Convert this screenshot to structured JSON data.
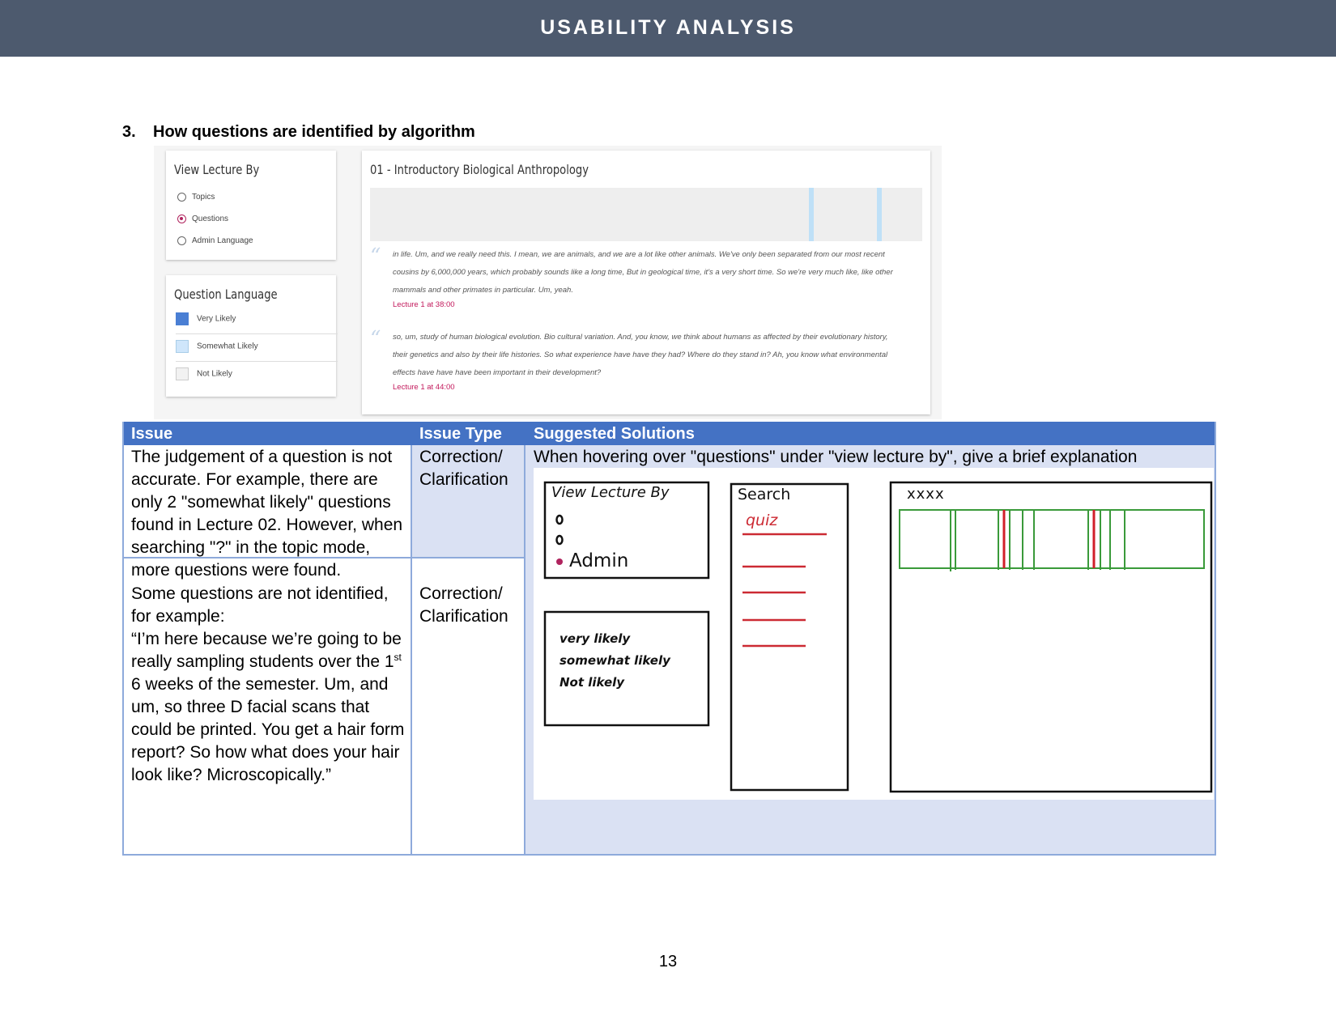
{
  "header": {
    "title": "USABILITY ANALYSIS"
  },
  "section": {
    "number": "3.",
    "title": "How questions are identified by algorithm"
  },
  "app": {
    "view_by": {
      "title": "View Lecture By",
      "options": [
        {
          "label": "Topics",
          "selected": false
        },
        {
          "label": "Questions",
          "selected": true
        },
        {
          "label": "Admin Language",
          "selected": false
        }
      ]
    },
    "question_language": {
      "title": "Question Language",
      "levels": [
        {
          "label": "Very Likely",
          "color": "#4a7fd4"
        },
        {
          "label": "Somewhat Likely",
          "color": "#cfe6fb"
        },
        {
          "label": "Not Likely",
          "color": "#f2f2f2"
        }
      ]
    },
    "lecture": {
      "title": "01 - Introductory Biological Anthropology",
      "quotes": [
        {
          "text": "in life. Um, and we really need this. I mean, we are animals, and we are a lot like other animals. We've only been separated from our most recent cousins by 6,000,000 years, which probably sounds like a long time, But in geological time, it's a very short time. So we're very much like, like other mammals and other primates in particular. Um, yeah.",
          "ref": "Lecture 1 at 38:00"
        },
        {
          "text": "so, um, study of human biological evolution. Bio cultural variation. And, you know, we think about humans as affected by their evolutionary history, their genetics and also by their life histories. So what experience have have they had? Where do they stand in? Ah, you know what environmental effects have have have been important in their development?",
          "ref": "Lecture 1 at 44:00"
        }
      ]
    }
  },
  "table": {
    "headers": {
      "issue": "Issue",
      "type": "Issue Type",
      "solution": "Suggested Solutions"
    },
    "rows": [
      {
        "issue": "The judgement of a question is not accurate. For example, there are only 2 \"somewhat likely\" questions found in Lecture 02. However, when searching \"?\" in the topic mode, more questions were found.",
        "type_line1": "Correction/",
        "type_line2": "Clarification",
        "solution": "When hovering over \"questions\" under \"view lecture by\", give a brief explanation"
      },
      {
        "issue_part1": "Some questions are not identified, for example:",
        "issue_part2": "“I’m here because we’re going to be really sampling students over the 1",
        "issue_sup": "st",
        "issue_part3": " 6 weeks of the semester. Um, and um, so three D facial scans that could be printed. You get a hair form report? So how what does your hair look like? Microscopically.”",
        "type_line1": "Correction/",
        "type_line2": "Clarification"
      }
    ]
  },
  "sketch": {
    "view_by_title": "View Lecture By",
    "admin_label": "Admin",
    "search_label": "Search",
    "search_term": "quiz",
    "title_placeholder": "xxxx",
    "levels": [
      "very likely",
      "somewhat likely",
      "Not likely"
    ]
  },
  "page_number": "13"
}
